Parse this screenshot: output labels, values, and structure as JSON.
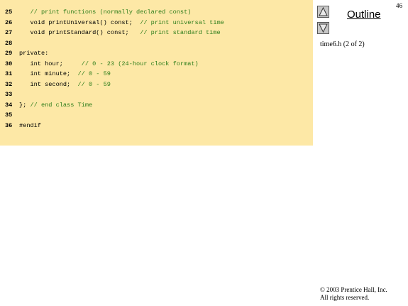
{
  "code": {
    "lines": [
      {
        "num": "25",
        "code": "   ",
        "comment": "// print functions (normally declared const)"
      },
      {
        "num": "26",
        "code": "   void printUniversal() const;  ",
        "comment": "// print universal time"
      },
      {
        "num": "27",
        "code": "   void printStandard() const;   ",
        "comment": "// print standard time"
      },
      {
        "num": "28",
        "code": "",
        "comment": ""
      },
      {
        "num": "29",
        "code": "private:",
        "comment": ""
      },
      {
        "num": "30",
        "code": "   int hour;     ",
        "comment": "// 0 - 23 (24-hour clock format)"
      },
      {
        "num": "31",
        "code": "   int minute;  ",
        "comment": "// 0 - 59"
      },
      {
        "num": "32",
        "code": "   int second;  ",
        "comment": "// 0 - 59"
      },
      {
        "num": "33",
        "code": "",
        "comment": ""
      },
      {
        "num": "34",
        "code": "}; ",
        "comment": "// end class Time"
      },
      {
        "num": "35",
        "code": "",
        "comment": ""
      },
      {
        "num": "36",
        "code": "#endif",
        "comment": ""
      }
    ]
  },
  "sidebar": {
    "page_number": "46",
    "outline_label": "Outline",
    "file_label": "time6.h (2 of 2)",
    "up_icon": "triangle-up-icon",
    "down_icon": "triangle-down-icon"
  },
  "footer": {
    "copyright_line1": "© 2003 Prentice Hall, Inc.",
    "copyright_line2": "All rights reserved."
  },
  "colors": {
    "panel_bg": "#fde8a6",
    "comment": "#2e7d1b"
  }
}
